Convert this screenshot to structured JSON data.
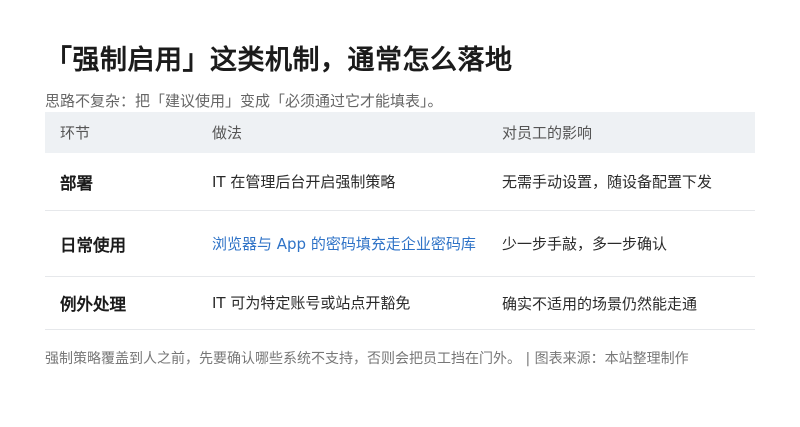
{
  "title": "「强制启用」这类机制，通常怎么落地",
  "subtitle": "思路不复杂：把「建议使用」变成「必须通过它才能填表」。",
  "table": {
    "headers": [
      "环节",
      "做法",
      "对员工的影响"
    ],
    "rows": [
      {
        "stage": "部署",
        "method": "IT 在管理后台开启强制策略",
        "impact": "无需手动设置，随设备配置下发"
      },
      {
        "stage": "日常使用",
        "method": "浏览器与 App 的密码填充走企业密码库",
        "impact": "少一步手敲，多一步确认"
      },
      {
        "stage": "例外处理",
        "method": "IT 可为特定账号或站点开豁免",
        "impact": "确实不适用的场景仍然能走通"
      }
    ]
  },
  "footer": "强制策略覆盖到人之前，先要确认哪些系统不支持，否则会把员工挡在门外。 | 图表来源：本站整理制作",
  "colors": {
    "header_bg": "#eef1f4",
    "link": "#2f73c7",
    "divider": "#e6e8eb"
  }
}
